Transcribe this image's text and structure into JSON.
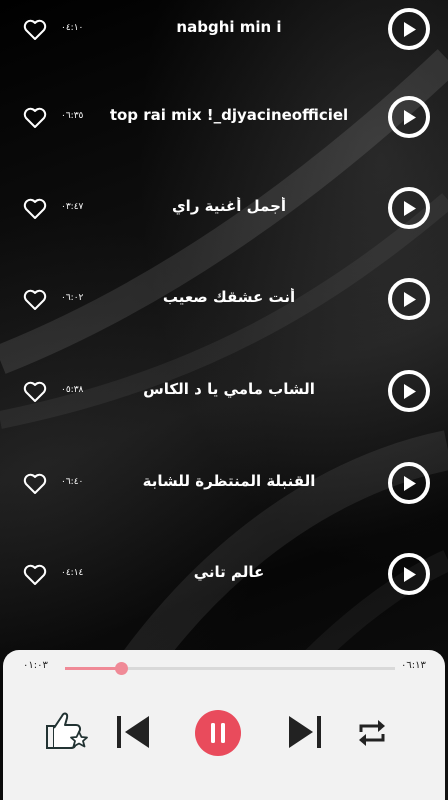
{
  "tracks": [
    {
      "title": "nabghi min i",
      "duration": "٠٤:١٠"
    },
    {
      "title": "top rai mix  !_djyacineofficiel",
      "duration": "٠٦:٣٥"
    },
    {
      "title": "أجمل أغنية راي",
      "duration": "٠٣:٤٧"
    },
    {
      "title": "أنت عشقك صعيب",
      "duration": "٠٦:٠٢"
    },
    {
      "title": "الشاب مامي  يا د الكاس",
      "duration": "٠٥:٣٨"
    },
    {
      "title": "القنبلة المنتظرة للشابة",
      "duration": "٠٦:٤٠"
    },
    {
      "title": "عالم  تاني",
      "duration": "٠٤:١٤"
    }
  ],
  "player": {
    "elapsed": "٠١:٠٣",
    "total": "٠٦:١٣",
    "progress": 0.17,
    "accent": "#e94b5c"
  },
  "icons": [
    "heart-icon",
    "play-icon",
    "thumbs-up-star-icon",
    "previous-icon",
    "pause-icon",
    "next-icon",
    "repeat-icon"
  ]
}
